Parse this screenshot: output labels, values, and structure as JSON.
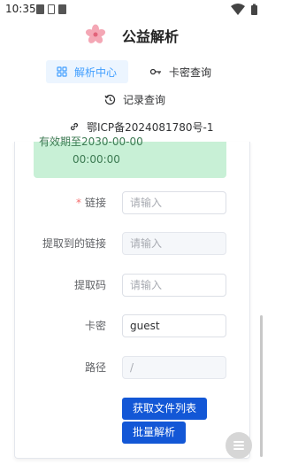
{
  "status_bar": {
    "time": "10:35"
  },
  "header": {
    "title": "公益解析",
    "logo_icon": "sakura-flower-icon"
  },
  "nav": {
    "parse_center": "解析中心",
    "card_query": "卡密查询",
    "record_query": "记录查询"
  },
  "icp": "鄂ICP备2024081780号-1",
  "notice": {
    "partial_top": "有效期至2030-00-00",
    "time": "00:00:00"
  },
  "form": {
    "link": {
      "label": "链接",
      "placeholder": "请输入"
    },
    "extracted_link": {
      "label": "提取到的链接",
      "placeholder": "请输入"
    },
    "extract_code": {
      "label": "提取码",
      "placeholder": "请输入"
    },
    "card_key": {
      "label": "卡密",
      "value": "guest"
    },
    "path": {
      "label": "路径",
      "value": "/"
    }
  },
  "buttons": {
    "get_file_list": "获取文件列表",
    "batch_parse": "批量解析"
  },
  "colors": {
    "accent": "#409eff",
    "primary_button": "#1357d6",
    "notice_bg": "#c8f0d6",
    "required": "#f56c6c"
  }
}
